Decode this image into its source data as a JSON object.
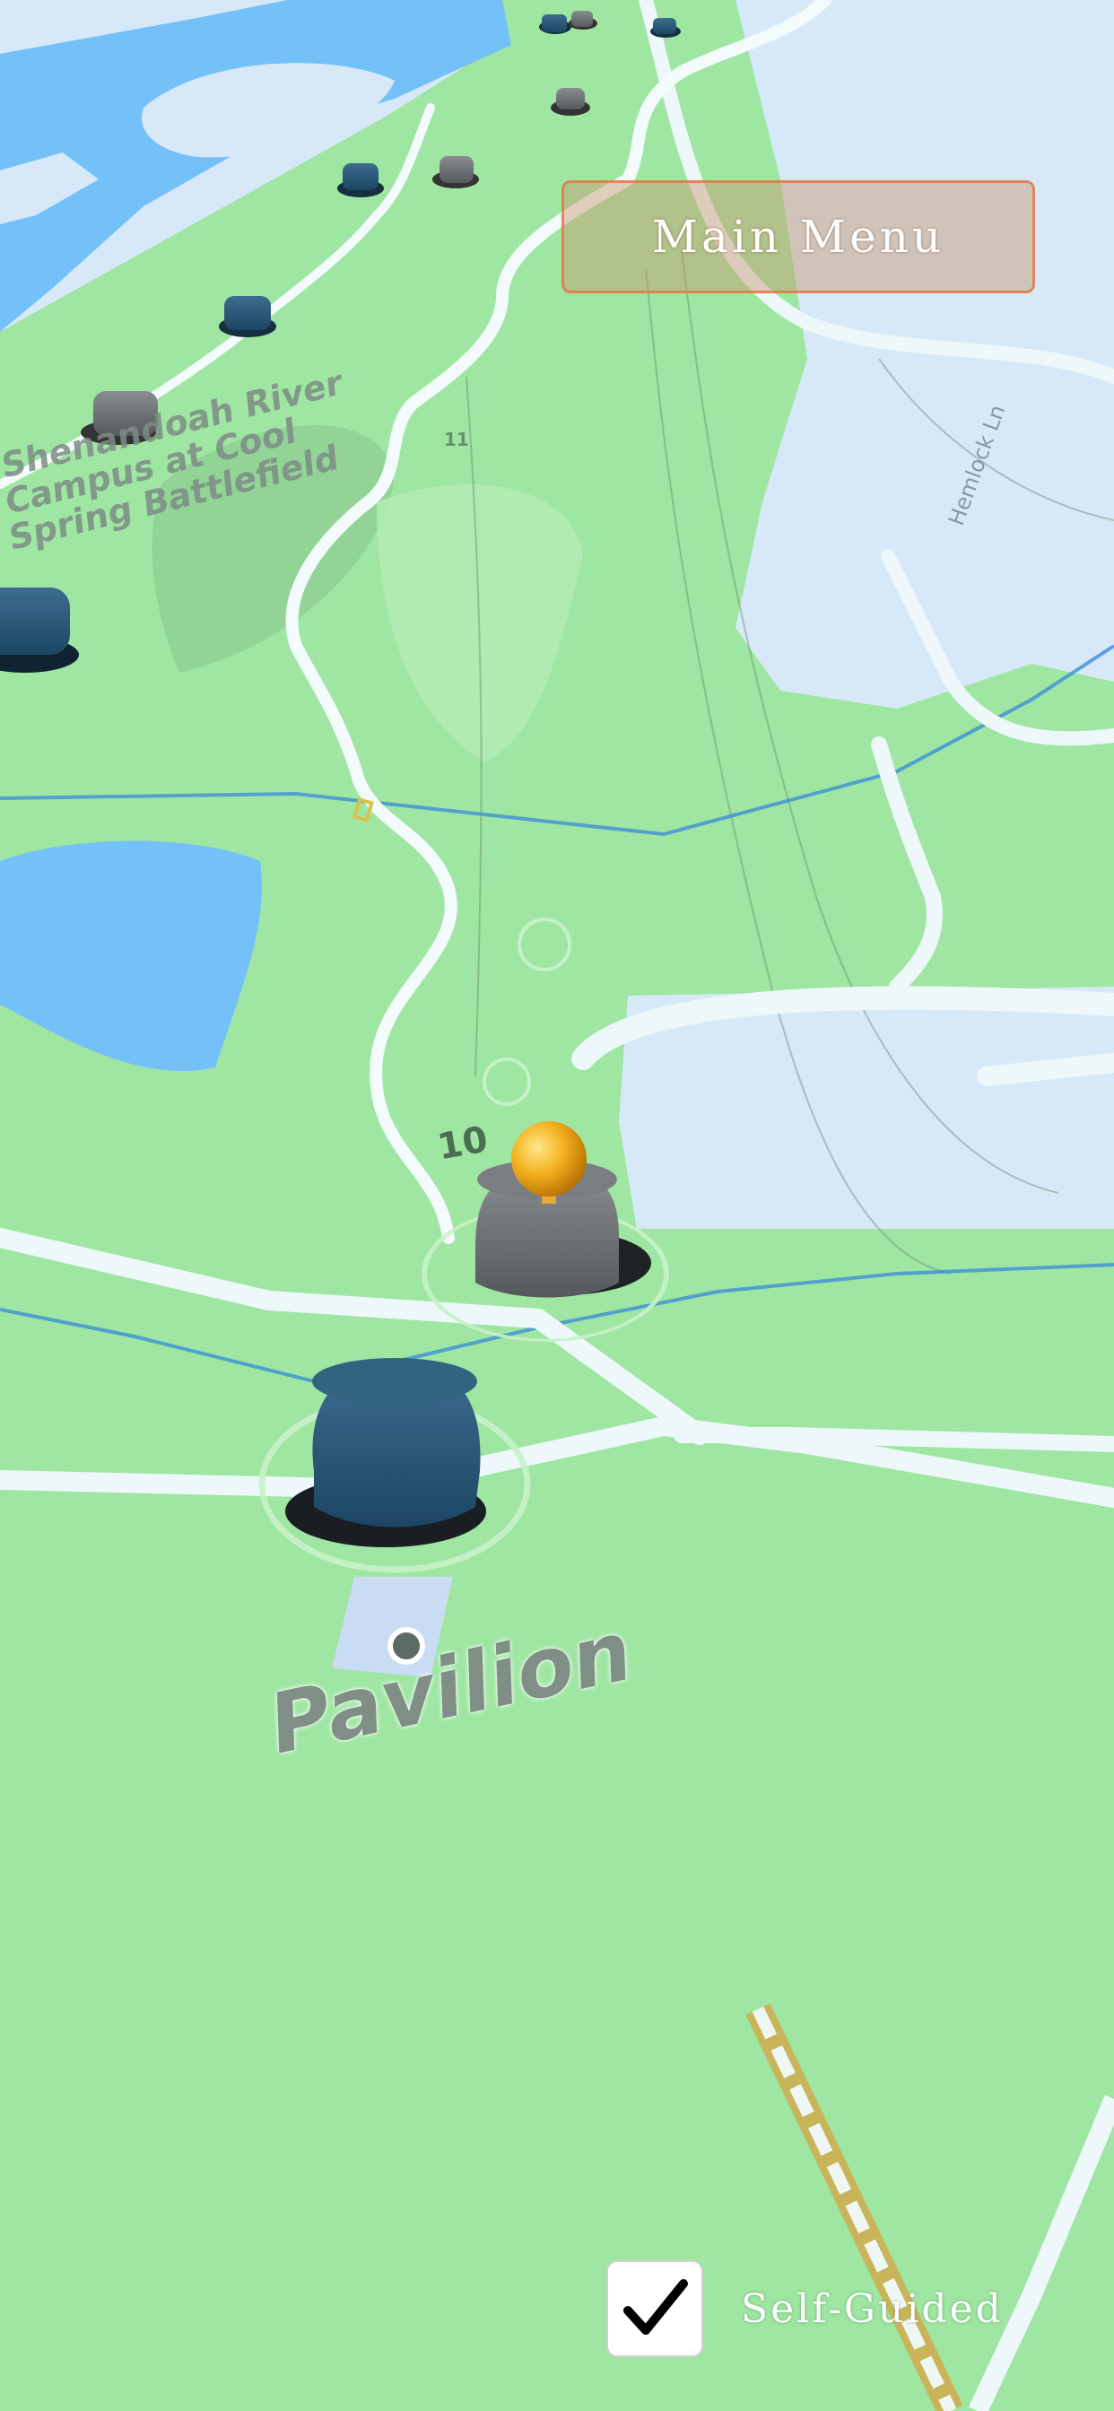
{
  "menu": {
    "main_menu_label": "Main Menu"
  },
  "map": {
    "campus_label": "Shenandoah River\nCampus at Cool\nSpring Battlefield",
    "pavilion_label": "Pavilion",
    "route_number": "10",
    "route_number_small": "11",
    "street_label": "Hemlock Ln",
    "colors": {
      "land": "#9ee6a2",
      "water": "#74c0f8",
      "road": "#eef8fb",
      "developed": "#d7e9f8",
      "trail": "#3f8ed8"
    }
  },
  "markers": {
    "soldier_hat_union_icon": "union-kepi-marker-icon",
    "soldier_hat_confederate_icon": "confederate-kepi-marker-icon",
    "player_location_icon": "player-location-icon"
  },
  "controls": {
    "self_guided_label": "Self-Guided",
    "self_guided_checked": true
  }
}
